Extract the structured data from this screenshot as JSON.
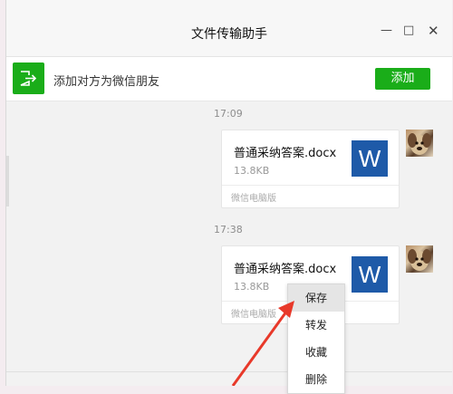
{
  "window": {
    "title": "文件传输助手"
  },
  "controls": {
    "minimize": "—",
    "maximize": "□",
    "close": "✕"
  },
  "notice": {
    "text": "添加对方为微信朋友",
    "button": "添加",
    "icon": "add-friend-icon"
  },
  "messages": [
    {
      "time": "17:09",
      "file_name": "普通采纳答案.docx",
      "file_size": "13.8KB",
      "source": "微信电脑版",
      "file_icon_letter": "W"
    },
    {
      "time": "17:38",
      "file_name": "普通采纳答案.docx",
      "file_size": "13.8KB",
      "source": "微信电脑版",
      "file_icon_letter": "W"
    }
  ],
  "context_menu": {
    "items": [
      "保存",
      "转发",
      "收藏",
      "删除"
    ],
    "active_index": 0
  },
  "colors": {
    "accent": "#1aad19",
    "word_blue": "#1e5aa8",
    "arrow": "#e8392a"
  }
}
